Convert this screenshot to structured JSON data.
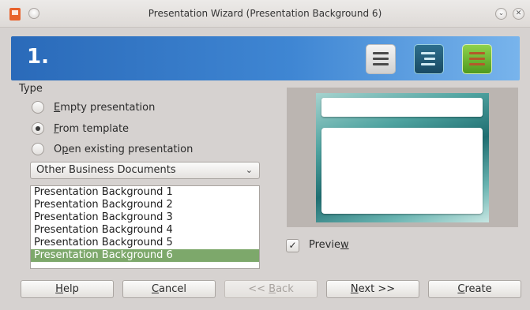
{
  "window": {
    "title": "Presentation Wizard (Presentation Background 6)",
    "minimize_glyph": "⌄",
    "close_glyph": "✕"
  },
  "banner": {
    "step": "1.",
    "colors": {
      "start": "#2a6ab9",
      "end": "#78b4ec"
    },
    "icons": [
      "list-icon",
      "outline-icon",
      "notes-icon"
    ]
  },
  "type_section": {
    "label": "Type",
    "options": [
      {
        "prefix": "",
        "mnemonic": "E",
        "rest": "mpty presentation",
        "checked": false
      },
      {
        "prefix": "",
        "mnemonic": "F",
        "rest": "rom template",
        "checked": true
      },
      {
        "prefix": "O",
        "mnemonic": "p",
        "rest": "en existing presentation",
        "checked": false
      }
    ]
  },
  "category_dropdown": {
    "selected": "Other Business Documents",
    "chevron": "⌄"
  },
  "template_list": {
    "items": [
      "Presentation Background 1",
      "Presentation Background 2",
      "Presentation Background 3",
      "Presentation Background 4",
      "Presentation Background 5",
      "Presentation Background 6"
    ],
    "selected_index": 5,
    "selection_color": "#7da86b"
  },
  "preview": {
    "checked": true,
    "check_glyph": "✓",
    "label_prefix": "Previe",
    "label_mnemonic": "w"
  },
  "buttons": {
    "help": {
      "mnemonic": "H",
      "rest": "elp"
    },
    "cancel": {
      "mnemonic": "C",
      "rest": "ancel"
    },
    "back": {
      "prefix": "<< ",
      "mnemonic": "B",
      "rest": "ack",
      "enabled": false
    },
    "next": {
      "mnemonic": "N",
      "rest": "ext >>"
    },
    "create": {
      "mnemonic": "C",
      "rest": "reate"
    }
  }
}
